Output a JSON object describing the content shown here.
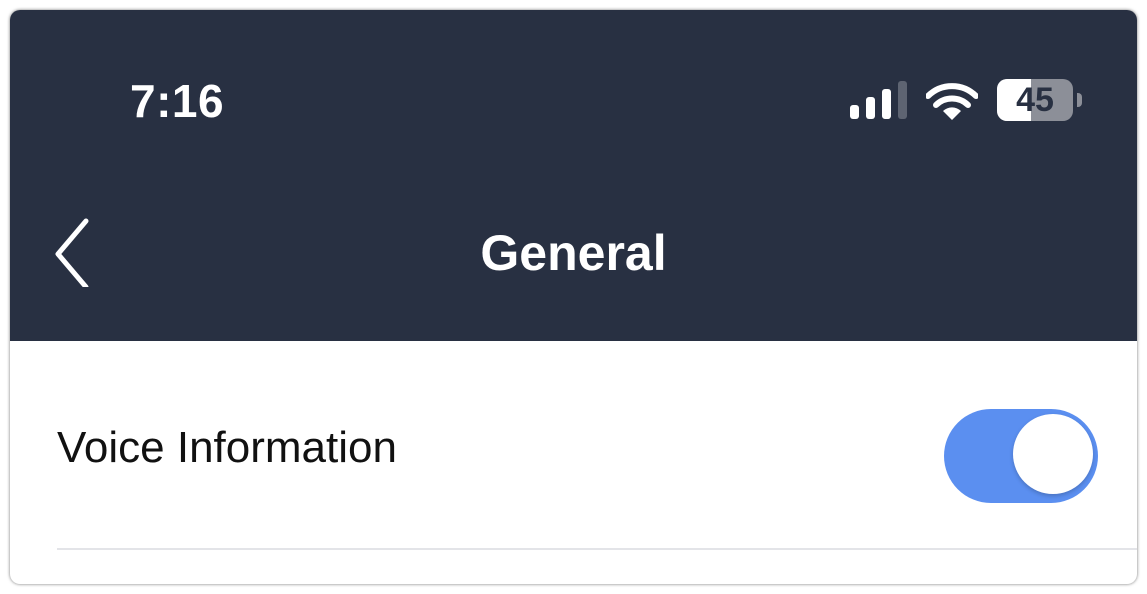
{
  "status_bar": {
    "time": "7:16",
    "battery_level": "45",
    "battery_fraction": 0.45,
    "signal_bars_active": 3,
    "signal_bars_total": 4,
    "icons": [
      "cellular-signal-icon",
      "wifi-icon",
      "battery-icon"
    ]
  },
  "nav": {
    "title": "General",
    "back_icon": "chevron-left-icon"
  },
  "settings": {
    "voice_information": {
      "label": "Voice Information",
      "enabled": true
    }
  },
  "colors": {
    "header_bg": "#283042",
    "toggle_on": "#5b8ff0",
    "text": "#111111",
    "divider": "#e3e4e8",
    "signal_inactive": "#5e6472"
  }
}
